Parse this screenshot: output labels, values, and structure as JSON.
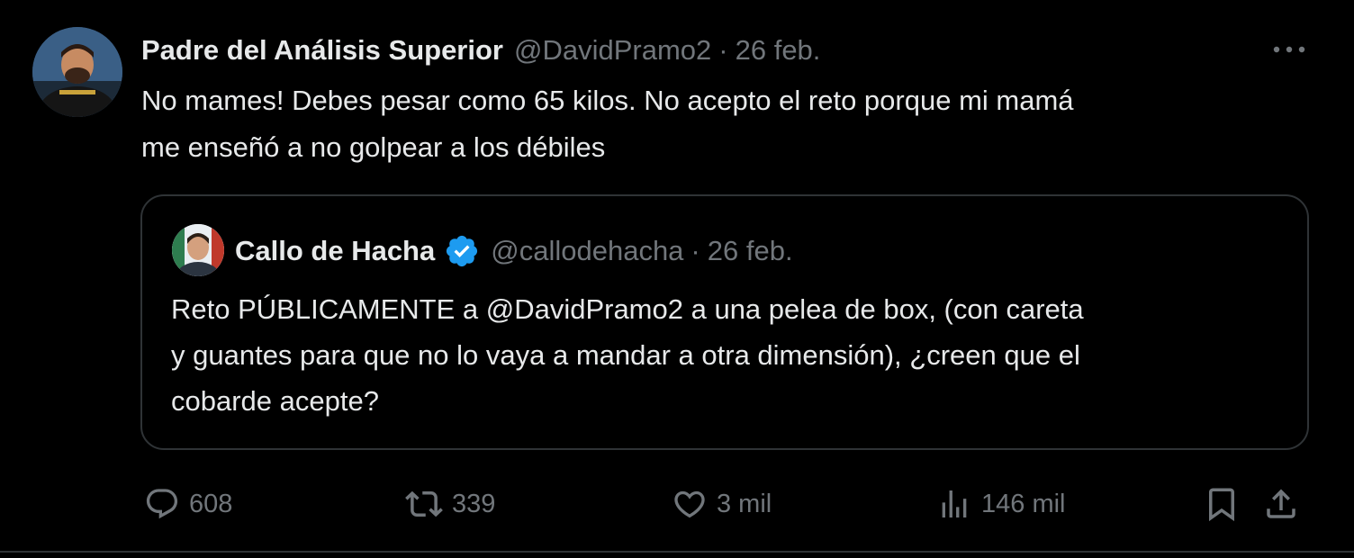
{
  "tweet": {
    "author_name": "Padre del Análisis Superior",
    "author_handle": "@DavidPramo2",
    "separator": "·",
    "date": "26 feb.",
    "text_line1": "No mames! Debes pesar como 65 kilos. No acepto el reto porque mi mamá",
    "text_line2": "me enseñó a no golpear a los débiles",
    "more_icon": "more-horizontal-icon"
  },
  "quoted_tweet": {
    "author_name": "Callo de Hacha",
    "author_handle": "@callodehacha",
    "separator": "·",
    "date": "26 feb.",
    "verified": true,
    "verified_color": "#1d9bf0",
    "text_line1": "Reto PÚBLICAMENTE a @DavidPramo2 a una pelea de box, (con careta",
    "text_line2": "y guantes para que no lo vaya a mandar a otra dimensión), ¿creen que el",
    "text_line3": "cobarde acepte?"
  },
  "actions": {
    "replies": "608",
    "retweets": "339",
    "likes": "3 mil",
    "views": "146 mil",
    "icons": [
      "reply-icon",
      "retweet-icon",
      "like-icon",
      "views-icon",
      "bookmark-icon",
      "share-icon"
    ]
  },
  "colors": {
    "background": "#000000",
    "text_primary": "#e7e9ea",
    "text_secondary": "#71767b",
    "border": "#2f3336",
    "accent": "#1d9bf0"
  }
}
